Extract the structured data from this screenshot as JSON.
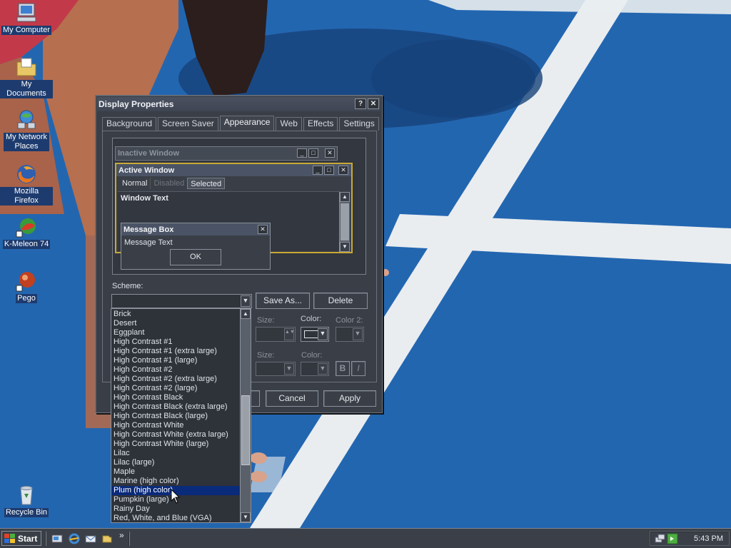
{
  "desktop": {
    "icons": [
      {
        "label": "My Computer",
        "icon": "computer-icon"
      },
      {
        "label": "My Documents",
        "icon": "folder-documents-icon"
      },
      {
        "label": "My Network Places",
        "icon": "network-icon"
      },
      {
        "label": "Mozilla Firefox",
        "icon": "firefox-icon"
      },
      {
        "label": "K-Meleon 74",
        "icon": "kmeleon-icon"
      },
      {
        "label": "Pego",
        "icon": "pego-icon"
      },
      {
        "label": "Recycle Bin",
        "icon": "recycle-bin-icon"
      }
    ]
  },
  "dialog": {
    "title": "Display Properties",
    "help_glyph": "?",
    "close_glyph": "✕",
    "tabs": [
      "Background",
      "Screen Saver",
      "Appearance",
      "Web",
      "Effects",
      "Settings"
    ],
    "active_tab": "Appearance",
    "preview": {
      "inactive_title": "Inactive Window",
      "active_title": "Active Window",
      "menu": [
        "Normal",
        "Disabled",
        "Selected"
      ],
      "window_text": "Window Text",
      "msgbox_title": "Message Box",
      "msgbox_text": "Message Text",
      "msgbox_ok": "OK"
    },
    "scheme_label": "Scheme:",
    "scheme_value": "",
    "save_as": "Save As...",
    "delete": "Delete",
    "size_label": "Size:",
    "color_label": "Color:",
    "color2_label": "Color 2:",
    "bold_glyph": "B",
    "italic_glyph": "I",
    "cancel": "Cancel",
    "apply": "Apply"
  },
  "scheme_list": {
    "items": [
      "Brick",
      "Desert",
      "Eggplant",
      "High Contrast #1",
      "High Contrast #1 (extra large)",
      "High Contrast #1 (large)",
      "High Contrast #2",
      "High Contrast #2 (extra large)",
      "High Contrast #2 (large)",
      "High Contrast Black",
      "High Contrast Black (extra large)",
      "High Contrast Black (large)",
      "High Contrast White",
      "High Contrast White (extra large)",
      "High Contrast White (large)",
      "Lilac",
      "Lilac (large)",
      "Maple",
      "Marine (high color)",
      "Plum (high color)",
      "Pumpkin (large)",
      "Rainy Day",
      "Red, White, and Blue (VGA)"
    ],
    "selected": "Plum (high color)",
    "scroll_position": 0.62
  },
  "taskbar": {
    "start_label": "Start",
    "clock": "5:43 PM"
  },
  "colors": {
    "track_blue": "#1f5fa8",
    "selection": "#0a2a7a",
    "dialog_bg": "#3a3f47"
  }
}
